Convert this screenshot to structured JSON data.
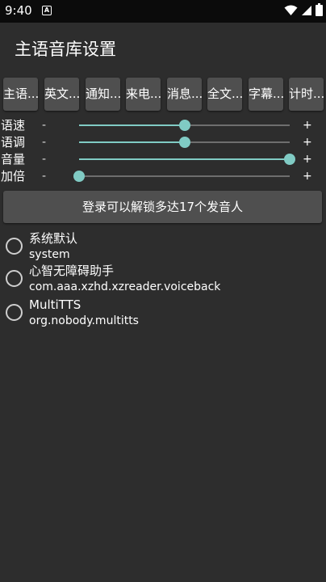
{
  "status_bar": {
    "time": "9:40",
    "notification_icon": "A",
    "icons": [
      "wifi-icon",
      "signal-icon",
      "battery-icon"
    ]
  },
  "app_bar": {
    "title": "主语音库设置"
  },
  "tabs": [
    {
      "label": "主语..."
    },
    {
      "label": "英文..."
    },
    {
      "label": "通知..."
    },
    {
      "label": "来电..."
    },
    {
      "label": "消息..."
    },
    {
      "label": "全文..."
    },
    {
      "label": "字幕..."
    },
    {
      "label": "计时..."
    }
  ],
  "sliders": [
    {
      "label": "语速",
      "minus": "-",
      "plus": "+",
      "value": 0.5
    },
    {
      "label": "语调",
      "minus": "-",
      "plus": "+",
      "value": 0.5
    },
    {
      "label": "音量",
      "minus": "-",
      "plus": "+",
      "value": 1.0
    },
    {
      "label": "加倍",
      "minus": "-",
      "plus": "+",
      "value": 0.0
    }
  ],
  "unlock_button": {
    "label": "登录可以解锁多达17个发音人"
  },
  "voices": [
    {
      "name": "系统默认",
      "package": "system",
      "selected": false
    },
    {
      "name": "心智无障碍助手",
      "package": "com.aaa.xzhd.xzreader.voiceback",
      "selected": false
    },
    {
      "name": "MultiTTS",
      "package": "org.nobody.multitts",
      "selected": false
    }
  ],
  "colors": {
    "background": "#2d2d2d",
    "status_bar": "#0b0b0b",
    "button": "#4f4f4f",
    "accent": "#80cbc4",
    "track": "#6e6e6e"
  }
}
